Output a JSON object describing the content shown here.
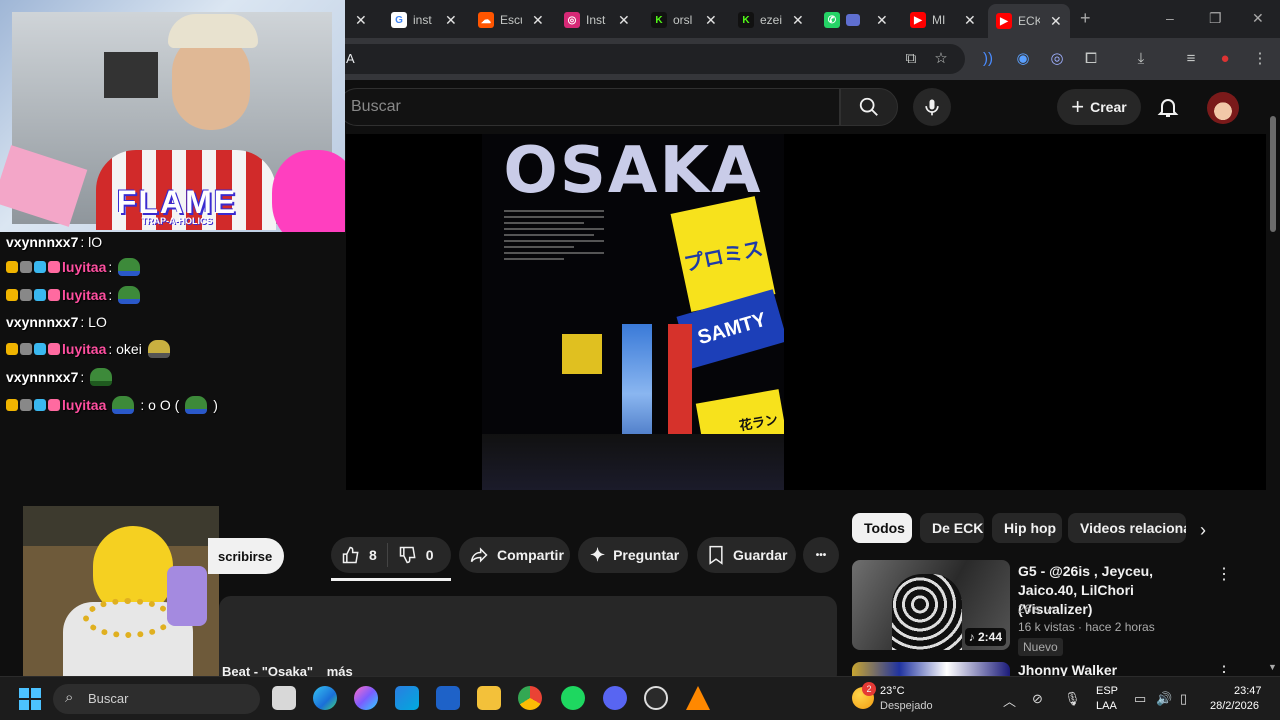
{
  "browser": {
    "tabs": [
      {
        "label": "inst",
        "icon": "google-icon",
        "color": "#4285f4"
      },
      {
        "label": "Escu",
        "icon": "soundcloud-icon",
        "color": "#ff5500"
      },
      {
        "label": "Inst",
        "icon": "instagram-icon",
        "color": "#d62976"
      },
      {
        "label": "orsl",
        "icon": "kick-icon",
        "color": "#53fc18"
      },
      {
        "label": "ezei",
        "icon": "kick-icon",
        "color": "#53fc18"
      },
      {
        "label": "",
        "icon": "whatsapp-icon",
        "color": "#25d366"
      },
      {
        "label": "MI",
        "icon": "youtube-icon",
        "color": "#ff0000"
      },
      {
        "label": "ECK",
        "icon": "youtube-icon",
        "color": "#ff0000"
      }
    ],
    "address": "A",
    "new_tab": "+",
    "win_min": "–",
    "win_max": "❐",
    "win_close": "✕"
  },
  "youtube": {
    "search_placeholder": "Buscar",
    "create_label": "Crear",
    "video": {
      "cover_title": "OSAKA",
      "sign_1": "プロミス",
      "sign_2": "SAMTY",
      "sign_3": "花ラン"
    },
    "subscribe_label": "scribirse",
    "likes": "8",
    "dislikes": "0",
    "share_label": "Compartir",
    "ask_label": "Preguntar",
    "save_label": "Guardar",
    "more_label": "•••",
    "description": {
      "title": "Beat - \"Osaka\"",
      "more": "más"
    },
    "chips": [
      "Todos",
      "De ECK",
      "Hip hop",
      "Videos relacionad"
    ],
    "recommended": [
      {
        "title": "G5 - @26is , Jeyceu, Jaico.40, LilChori (Visualizer)",
        "channel": "26is",
        "meta": "16 k vistas · hace 2 horas",
        "badge": "Nuevo",
        "duration": "2:44"
      },
      {
        "title": "Jhonny Walker"
      }
    ]
  },
  "stream": {
    "overlay_logo": "FLAME",
    "overlay_sub": "TRAP-A-HOLICS",
    "chat": [
      {
        "user": "vxynnnxx7",
        "text": ": lO",
        "badges": false,
        "pink": false
      },
      {
        "user": "luyitaa",
        "text": ":",
        "badges": true,
        "pink": true,
        "emote": true
      },
      {
        "user": "luyitaa",
        "text": ":",
        "badges": true,
        "pink": true,
        "emote": true
      },
      {
        "user": "vxynnnxx7",
        "text": ": LO",
        "badges": false,
        "pink": false
      },
      {
        "user": "luyitaa",
        "text": ": okei",
        "badges": true,
        "pink": true,
        "emote": true
      },
      {
        "user": "vxynnnxx7",
        "text": ":",
        "badges": false,
        "pink": false,
        "emote": true
      },
      {
        "user": "luyitaa",
        "text": ": o O (",
        "badges": true,
        "pink": true,
        "emote": true,
        "tail": ")"
      }
    ]
  },
  "taskbar": {
    "search_placeholder": "Buscar",
    "weather_badge": "2",
    "temperature": "23°C",
    "condition": "Despejado",
    "lang1": "ESP",
    "lang2": "LAA",
    "time": "23:47",
    "date": "28/2/2026"
  }
}
